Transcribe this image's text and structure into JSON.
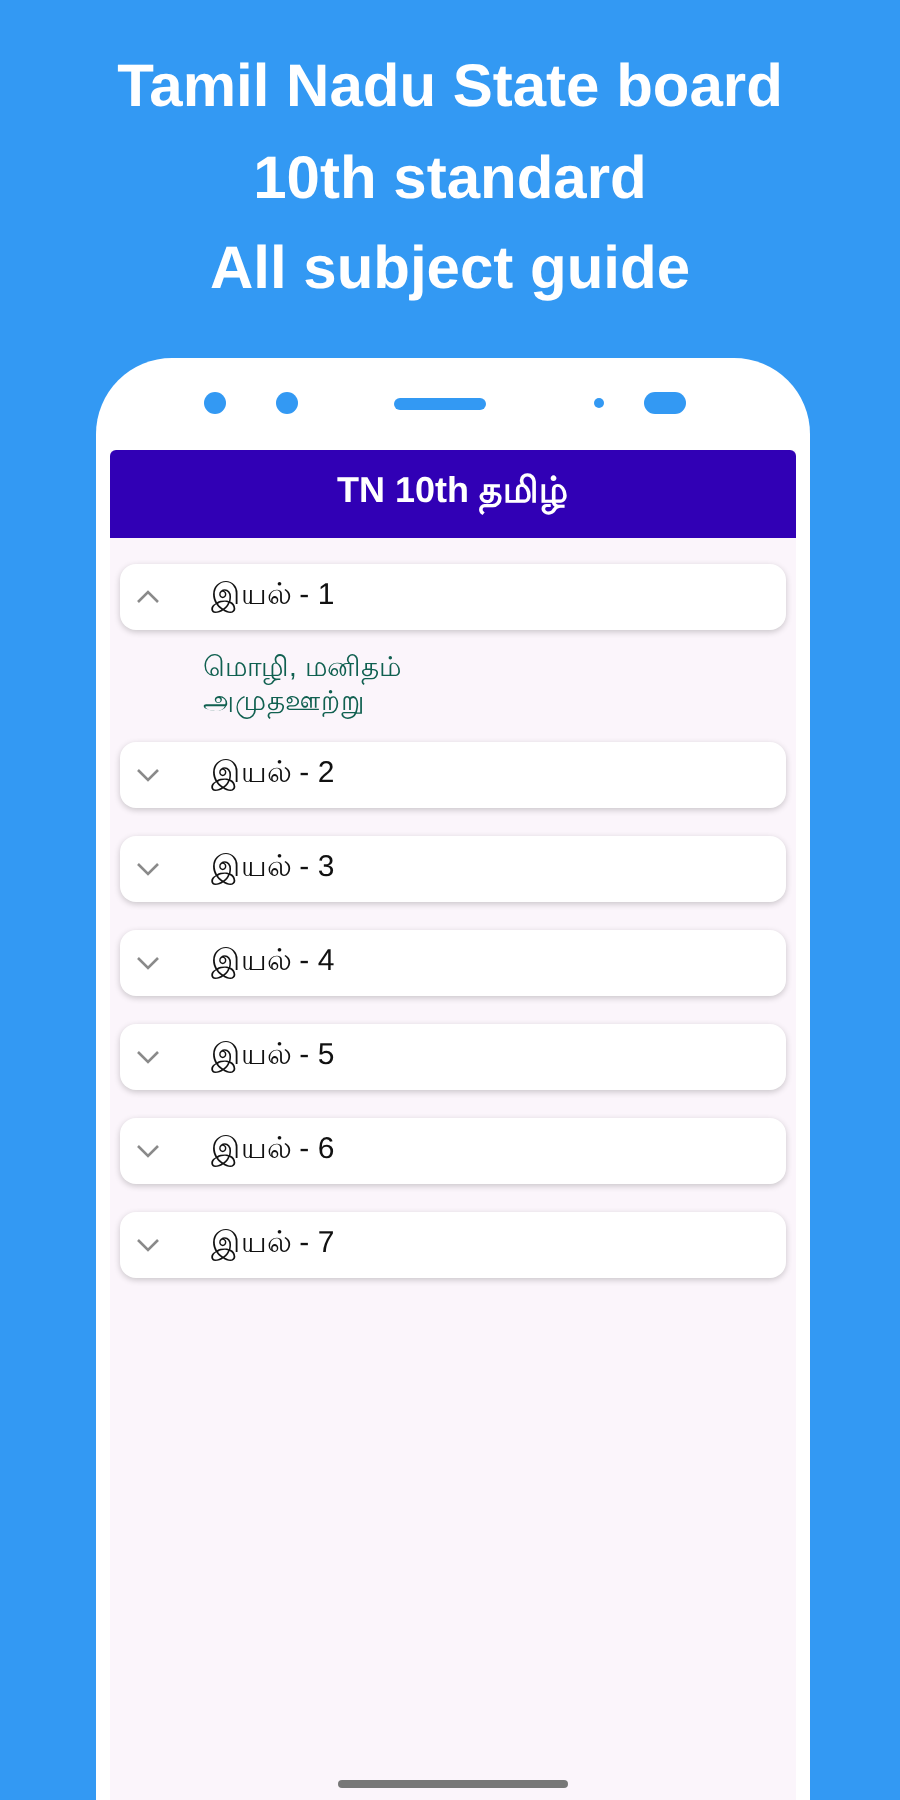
{
  "headline": [
    "Tamil Nadu State board",
    "10th standard",
    "All subject guide"
  ],
  "app_bar": {
    "title": "TN 10th தமிழ்"
  },
  "sections": [
    {
      "label": "இயல் - 1",
      "expanded": true,
      "items": [
        "மொழி, மனிதம்",
        "அமுதஊற்று"
      ]
    },
    {
      "label": "இயல் - 2",
      "expanded": false
    },
    {
      "label": "இயல் - 3",
      "expanded": false
    },
    {
      "label": "இயல் - 4",
      "expanded": false
    },
    {
      "label": "இயல் - 5",
      "expanded": false
    },
    {
      "label": "இயல் - 6",
      "expanded": false
    },
    {
      "label": "இயல் - 7",
      "expanded": false
    }
  ]
}
